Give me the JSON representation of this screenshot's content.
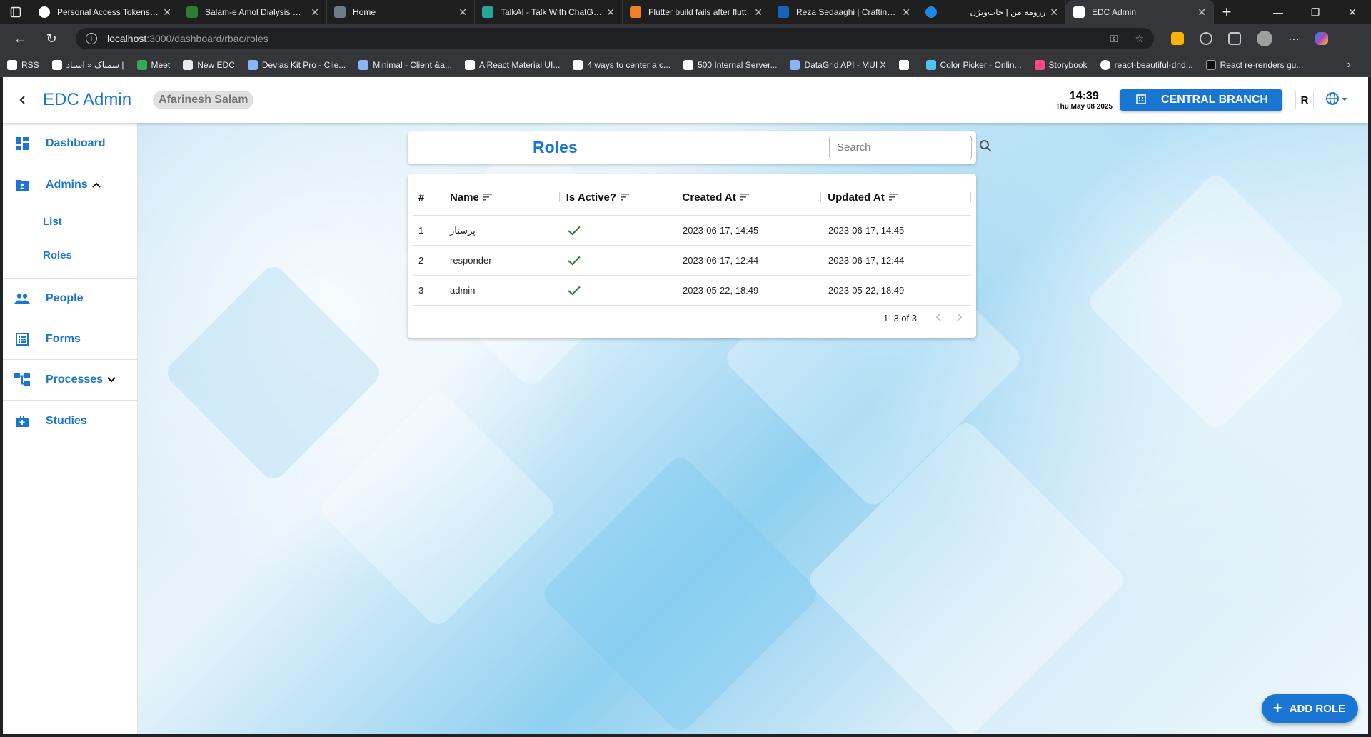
{
  "browser": {
    "tabs": [
      {
        "title": "Personal Access Tokens (Cla",
        "color": "#ffffff"
      },
      {
        "title": "Salam-e Amol Dialysis Clinic",
        "color": "#2e7d32"
      },
      {
        "title": "Home",
        "color": "#6c7a89"
      },
      {
        "title": "TalkAI - Talk With ChatGPT",
        "color": "#26a69a"
      },
      {
        "title": "Flutter build fails after flutt",
        "color": "#f48024"
      },
      {
        "title": "Reza Sedaaghi | Crafting Sc",
        "color": "#1565c0"
      },
      {
        "title": "رزومه من | جاب‌ویژن",
        "color": "#1e88e5"
      },
      {
        "title": "EDC Admin",
        "color": "#ffffff"
      }
    ],
    "url_host": "localhost",
    "url_path": ":3000/dashboard/rbac/roles",
    "bookmarks": [
      "RSS",
      "سمتاک « استاد |",
      "Meet",
      "New EDC",
      "Devias Kit Pro - Clie...",
      "Minimal - Client &a...",
      "A React Material UI...",
      "4 ways to center a c...",
      "500 Internal Server...",
      "DataGrid API - MUI X",
      "",
      "Color Picker - Onlin...",
      "Storybook",
      "react-beautiful-dnd...",
      "React re-renders gu..."
    ]
  },
  "app": {
    "title": "EDC Admin",
    "user": "Afarinesh Salam",
    "time": "14:39",
    "date": "Thu May 08 2025",
    "branch": "CENTRAL BRANCH",
    "avatar_letter": "R",
    "accent": "#1976d2"
  },
  "sidebar": {
    "items": [
      {
        "label": "Dashboard"
      },
      {
        "label": "Admins"
      },
      {
        "label": "People"
      },
      {
        "label": "Forms"
      },
      {
        "label": "Processes"
      },
      {
        "label": "Studies"
      }
    ],
    "admins_sub": [
      {
        "label": "List"
      },
      {
        "label": "Roles"
      }
    ]
  },
  "roles": {
    "title": "Roles",
    "search_placeholder": "Search",
    "columns": [
      "#",
      "Name",
      "Is Active?",
      "Created At",
      "Updated At"
    ],
    "rows": [
      {
        "num": "1",
        "name": "پرستار",
        "active": true,
        "created": "2023-06-17, 14:45",
        "updated": "2023-06-17, 14:45"
      },
      {
        "num": "2",
        "name": "responder",
        "active": true,
        "created": "2023-06-17, 12:44",
        "updated": "2023-06-17, 12:44"
      },
      {
        "num": "3",
        "name": "admin",
        "active": true,
        "created": "2023-05-22, 18:49",
        "updated": "2023-05-22, 18:49"
      }
    ],
    "pagination": "1–3 of 3",
    "add_button": "ADD ROLE"
  }
}
